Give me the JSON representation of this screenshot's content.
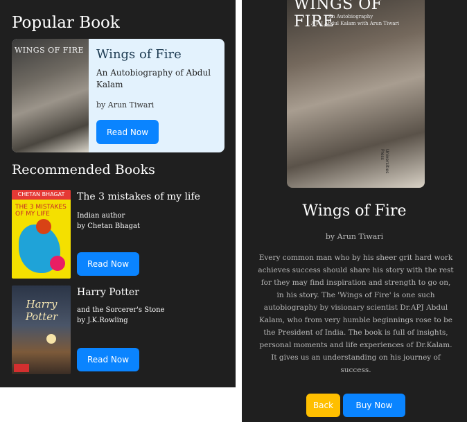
{
  "left_screen": {
    "popular_section_title": "Popular Book",
    "popular_book": {
      "cover_text": "WINGS OF FIRE",
      "title": "Wings of Fire",
      "subtitle": "An Autobiography of Abdul Kalam",
      "author": "by Arun Tiwari",
      "button_label": "Read Now"
    },
    "recommended_section_title": "Recommended Books",
    "recommended": [
      {
        "cover_author_strip": "CHETAN BHAGAT",
        "cover_text": "THE 3 MISTAKES OF MY LIFE",
        "title": "The 3 mistakes of my life",
        "line1": "Indian author",
        "line2": "by Chetan Bhagat",
        "button_label": "Read Now"
      },
      {
        "cover_text": "Harry Potter",
        "title": "Harry Potter",
        "line1": "and the Sorcerer's Stone",
        "line2": "by J.K.Rowling",
        "button_label": "Read Now"
      }
    ]
  },
  "right_screen": {
    "cover": {
      "title_text": "WINGS OF FIRE",
      "subtitle_text": "An Autobiography",
      "author_text": "A P J Abdul Kalam with Arun Tiwari",
      "publisher_text": "Universities Press"
    },
    "title": "Wings of Fire",
    "author": "by Arun Tiwari",
    "description": "Every common man who by his sheer grit hard work achieves success should share his story with the rest for they may find inspiration and strength to go on, in his story. The 'Wings of Fire' is one such autobiography by visionary scientist Dr.APJ Abdul Kalam, who from very humble beginnings rose to be the President of India. The book is full of insights, personal moments and life experiences of Dr.Kalam. It gives us an understanding on his journey of success.",
    "back_label": "Back",
    "buy_label": "Buy Now"
  },
  "colors": {
    "background": "#1f1f1f",
    "card_light": "#e3f2fd",
    "primary_button": "#0a84ff",
    "back_button": "#ffbf00"
  }
}
